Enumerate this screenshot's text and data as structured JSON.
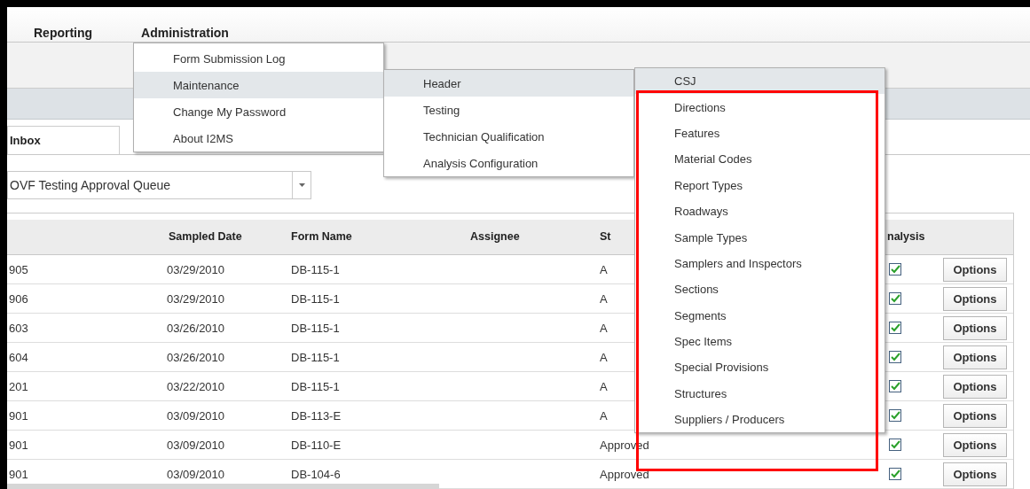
{
  "menu_bar": [
    "Reporting",
    "Administration"
  ],
  "tabs": [
    {
      "label": "Inbox",
      "selected": true
    }
  ],
  "queue_select": {
    "value": "OVF Testing Approval Queue"
  },
  "table": {
    "columns": [
      "Sampled Date",
      "Form Name",
      "Assignee",
      "St",
      "nalysis"
    ],
    "rows": [
      {
        "column_1": "905",
        "sampled_date": "03/29/2010",
        "form_name": "DB-115-1",
        "status": "A",
        "checked": true,
        "action": "Options"
      },
      {
        "column_1": "906",
        "sampled_date": "03/29/2010",
        "form_name": "DB-115-1",
        "status": "A",
        "checked": true,
        "action": "Options"
      },
      {
        "column_1": "603",
        "sampled_date": "03/26/2010",
        "form_name": "DB-115-1",
        "status": "A",
        "checked": true,
        "action": "Options"
      },
      {
        "column_1": "604",
        "sampled_date": "03/26/2010",
        "form_name": "DB-115-1",
        "status": "A",
        "checked": true,
        "action": "Options"
      },
      {
        "column_1": "201",
        "sampled_date": "03/22/2010",
        "form_name": "DB-115-1",
        "status": "A",
        "checked": true,
        "action": "Options"
      },
      {
        "column_1": "901",
        "sampled_date": "03/09/2010",
        "form_name": "DB-113-E",
        "status": "A",
        "checked": true,
        "action": "Options"
      },
      {
        "column_1": "901",
        "sampled_date": "03/09/2010",
        "form_name": "DB-110-E",
        "status": "Approved",
        "checked": true,
        "action": "Options"
      },
      {
        "column_1": "901",
        "sampled_date": "03/09/2010",
        "form_name": "DB-104-6",
        "status": "Approved",
        "checked": true,
        "action": "Options"
      }
    ]
  },
  "administration_menu": [
    {
      "label": "Form Submission Log",
      "selected": false
    },
    {
      "label": "Maintenance",
      "selected": true
    },
    {
      "label": "Change My Password",
      "selected": false
    },
    {
      "label": "About I2MS",
      "selected": false
    }
  ],
  "maintenance_submenu": [
    {
      "label": "Header",
      "selected": true
    },
    {
      "label": "Testing",
      "selected": false
    },
    {
      "label": "Technician Qualification",
      "selected": false
    },
    {
      "label": "Analysis Configuration",
      "selected": false
    }
  ],
  "header_submenu": [
    {
      "label": "CSJ",
      "selected": true
    },
    {
      "label": "Directions",
      "selected": false
    },
    {
      "label": "Features",
      "selected": false
    },
    {
      "label": "Material Codes",
      "selected": false
    },
    {
      "label": "Report Types",
      "selected": false
    },
    {
      "label": "Roadways",
      "selected": false
    },
    {
      "label": "Sample Types",
      "selected": false
    },
    {
      "label": "Samplers and Inspectors",
      "selected": false
    },
    {
      "label": "Sections",
      "selected": false
    },
    {
      "label": "Segments",
      "selected": false
    },
    {
      "label": "Spec Items",
      "selected": false
    },
    {
      "label": "Special Provisions",
      "selected": false
    },
    {
      "label": "Structures",
      "selected": false
    },
    {
      "label": "Suppliers / Producers",
      "selected": false
    }
  ]
}
